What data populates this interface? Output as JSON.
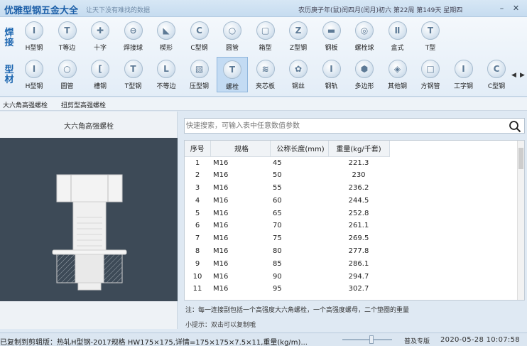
{
  "app": {
    "title": "优雅型钢五金大全",
    "subtitle": "让天下没有难找的数据",
    "lunar_date": "农历庚子年(鼠)闰四月(闰月)初六 第22周 第149天 星期四"
  },
  "window": {
    "minimize": "–",
    "close": "✕"
  },
  "toolbar": {
    "row1_label": "焊接",
    "row2_label": "型材",
    "row1_items": [
      {
        "label": "H型钢",
        "glyph": "I"
      },
      {
        "label": "T等边",
        "glyph": "T"
      },
      {
        "label": "十字",
        "glyph": "✚"
      },
      {
        "label": "焊接球",
        "glyph": "⊖"
      },
      {
        "label": "楔形",
        "glyph": "◣"
      },
      {
        "label": "C型钢",
        "glyph": "C"
      },
      {
        "label": "圆管",
        "glyph": "○"
      },
      {
        "label": "箱型",
        "glyph": "▢"
      },
      {
        "label": "Z型钢",
        "glyph": "Z"
      },
      {
        "label": "钢板",
        "glyph": "▬"
      },
      {
        "label": "螺栓球",
        "glyph": "◎"
      },
      {
        "label": "盒式",
        "glyph": "Ⅱ"
      },
      {
        "label": "T型",
        "glyph": "T"
      }
    ],
    "row2_items": [
      {
        "label": "H型钢",
        "glyph": "I"
      },
      {
        "label": "圆管",
        "glyph": "○"
      },
      {
        "label": "槽钢",
        "glyph": "["
      },
      {
        "label": "T型钢",
        "glyph": "T"
      },
      {
        "label": "不等边",
        "glyph": "L"
      },
      {
        "label": "压型钢",
        "glyph": "▧"
      },
      {
        "label": "螺栓",
        "glyph": "T"
      },
      {
        "label": "夹芯板",
        "glyph": "≋"
      },
      {
        "label": "钢丝",
        "glyph": "✿"
      },
      {
        "label": "钢轨",
        "glyph": "I"
      },
      {
        "label": "多边形",
        "glyph": "⬢"
      },
      {
        "label": "其他钢",
        "glyph": "◈"
      },
      {
        "label": "方钢管",
        "glyph": "□"
      },
      {
        "label": "工字钢",
        "glyph": "I"
      },
      {
        "label": "C型钢",
        "glyph": "C"
      }
    ],
    "selected": "螺栓",
    "scroll_prev": "◀",
    "scroll_next": "▶"
  },
  "subtabs": [
    "大六角高强螺栓",
    "扭剪型高强螺栓"
  ],
  "left_panel": {
    "title": "大六角高强螺栓"
  },
  "search": {
    "placeholder": "快速搜索，可输入表中任意数值参数",
    "value": ""
  },
  "table": {
    "headers": [
      "序号",
      "规格",
      "公称长度(mm)",
      "重量(kg/千套)"
    ],
    "rows": [
      [
        "1",
        "M16",
        "45",
        "221.3"
      ],
      [
        "2",
        "M16",
        "50",
        "230"
      ],
      [
        "3",
        "M16",
        "55",
        "236.2"
      ],
      [
        "4",
        "M16",
        "60",
        "244.5"
      ],
      [
        "5",
        "M16",
        "65",
        "252.8"
      ],
      [
        "6",
        "M16",
        "70",
        "261.1"
      ],
      [
        "7",
        "M16",
        "75",
        "269.5"
      ],
      [
        "8",
        "M16",
        "80",
        "277.8"
      ],
      [
        "9",
        "M16",
        "85",
        "286.1"
      ],
      [
        "10",
        "M16",
        "90",
        "294.7"
      ],
      [
        "11",
        "M16",
        "95",
        "302.7"
      ]
    ]
  },
  "note": "注：每一连接副包括一个高强度大六角螺栓，一个高强度螺母，二个垫圈的重量",
  "hint": "小提示：双击可以复制哦",
  "statusbar": {
    "text": "已复制到剪辑版：热轧H型钢-2017规格 HW175×175,详情=175×175×7.5×11,重量(kg/m)...",
    "edition": "普及专版",
    "datetime": "2020-05-28 10:07:58"
  },
  "colors": {
    "accent": "#1c66b0",
    "image_bg": "#3d4a57"
  }
}
